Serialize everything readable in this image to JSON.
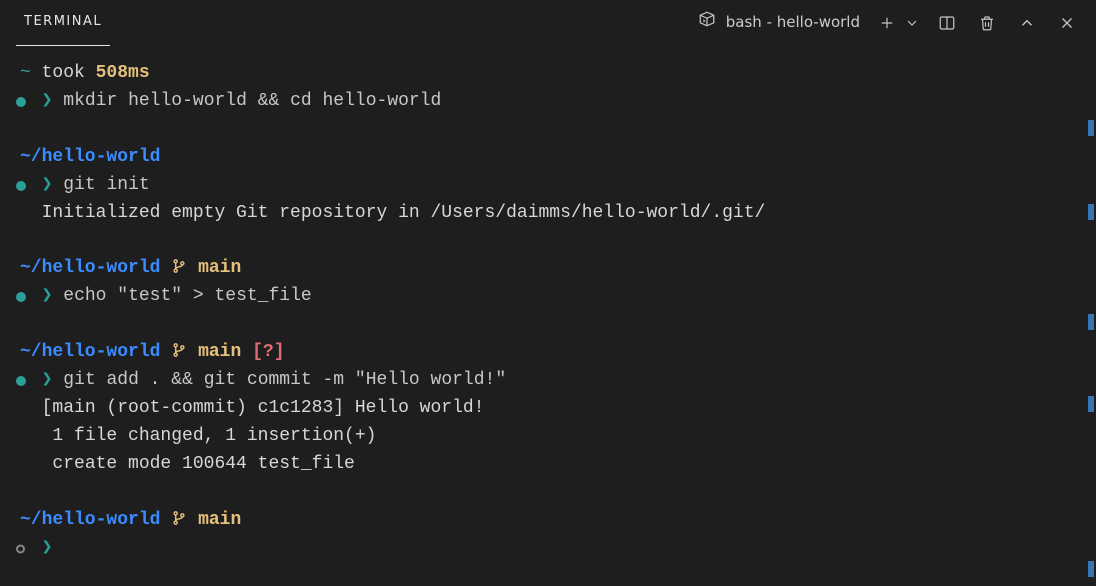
{
  "header": {
    "tab_label": "TERMINAL",
    "shell_label": "bash - hello-world"
  },
  "blocks": [
    {
      "timing_prefix": "~",
      "timing_text": " took ",
      "timing_value": "508ms",
      "bullet": "teal",
      "command": "mkdir hello-world && cd hello-world",
      "output": []
    },
    {
      "path_prefix": "~/",
      "path": "hello-world",
      "branch": null,
      "status": null,
      "bullet": "teal",
      "command": "git init",
      "output": [
        "Initialized empty Git repository in /Users/daimms/hello-world/.git/"
      ]
    },
    {
      "path_prefix": "~/",
      "path": "hello-world",
      "branch": "main",
      "status": null,
      "bullet": "teal",
      "command": "echo \"test\" > test_file",
      "output": []
    },
    {
      "path_prefix": "~/",
      "path": "hello-world",
      "branch": "main",
      "status": "[?]",
      "bullet": "teal",
      "command": "git add . && git commit -m \"Hello world!\"",
      "output": [
        "[main (root-commit) c1c1283] Hello world!",
        " 1 file changed, 1 insertion(+)",
        " create mode 100644 test_file"
      ]
    },
    {
      "path_prefix": "~/",
      "path": "hello-world",
      "branch": "main",
      "status": null,
      "bullet": "ring",
      "command": "",
      "output": []
    }
  ],
  "glyphs": {
    "arrow": "❯",
    "branch_icon": "",
    "tilde": "~"
  }
}
